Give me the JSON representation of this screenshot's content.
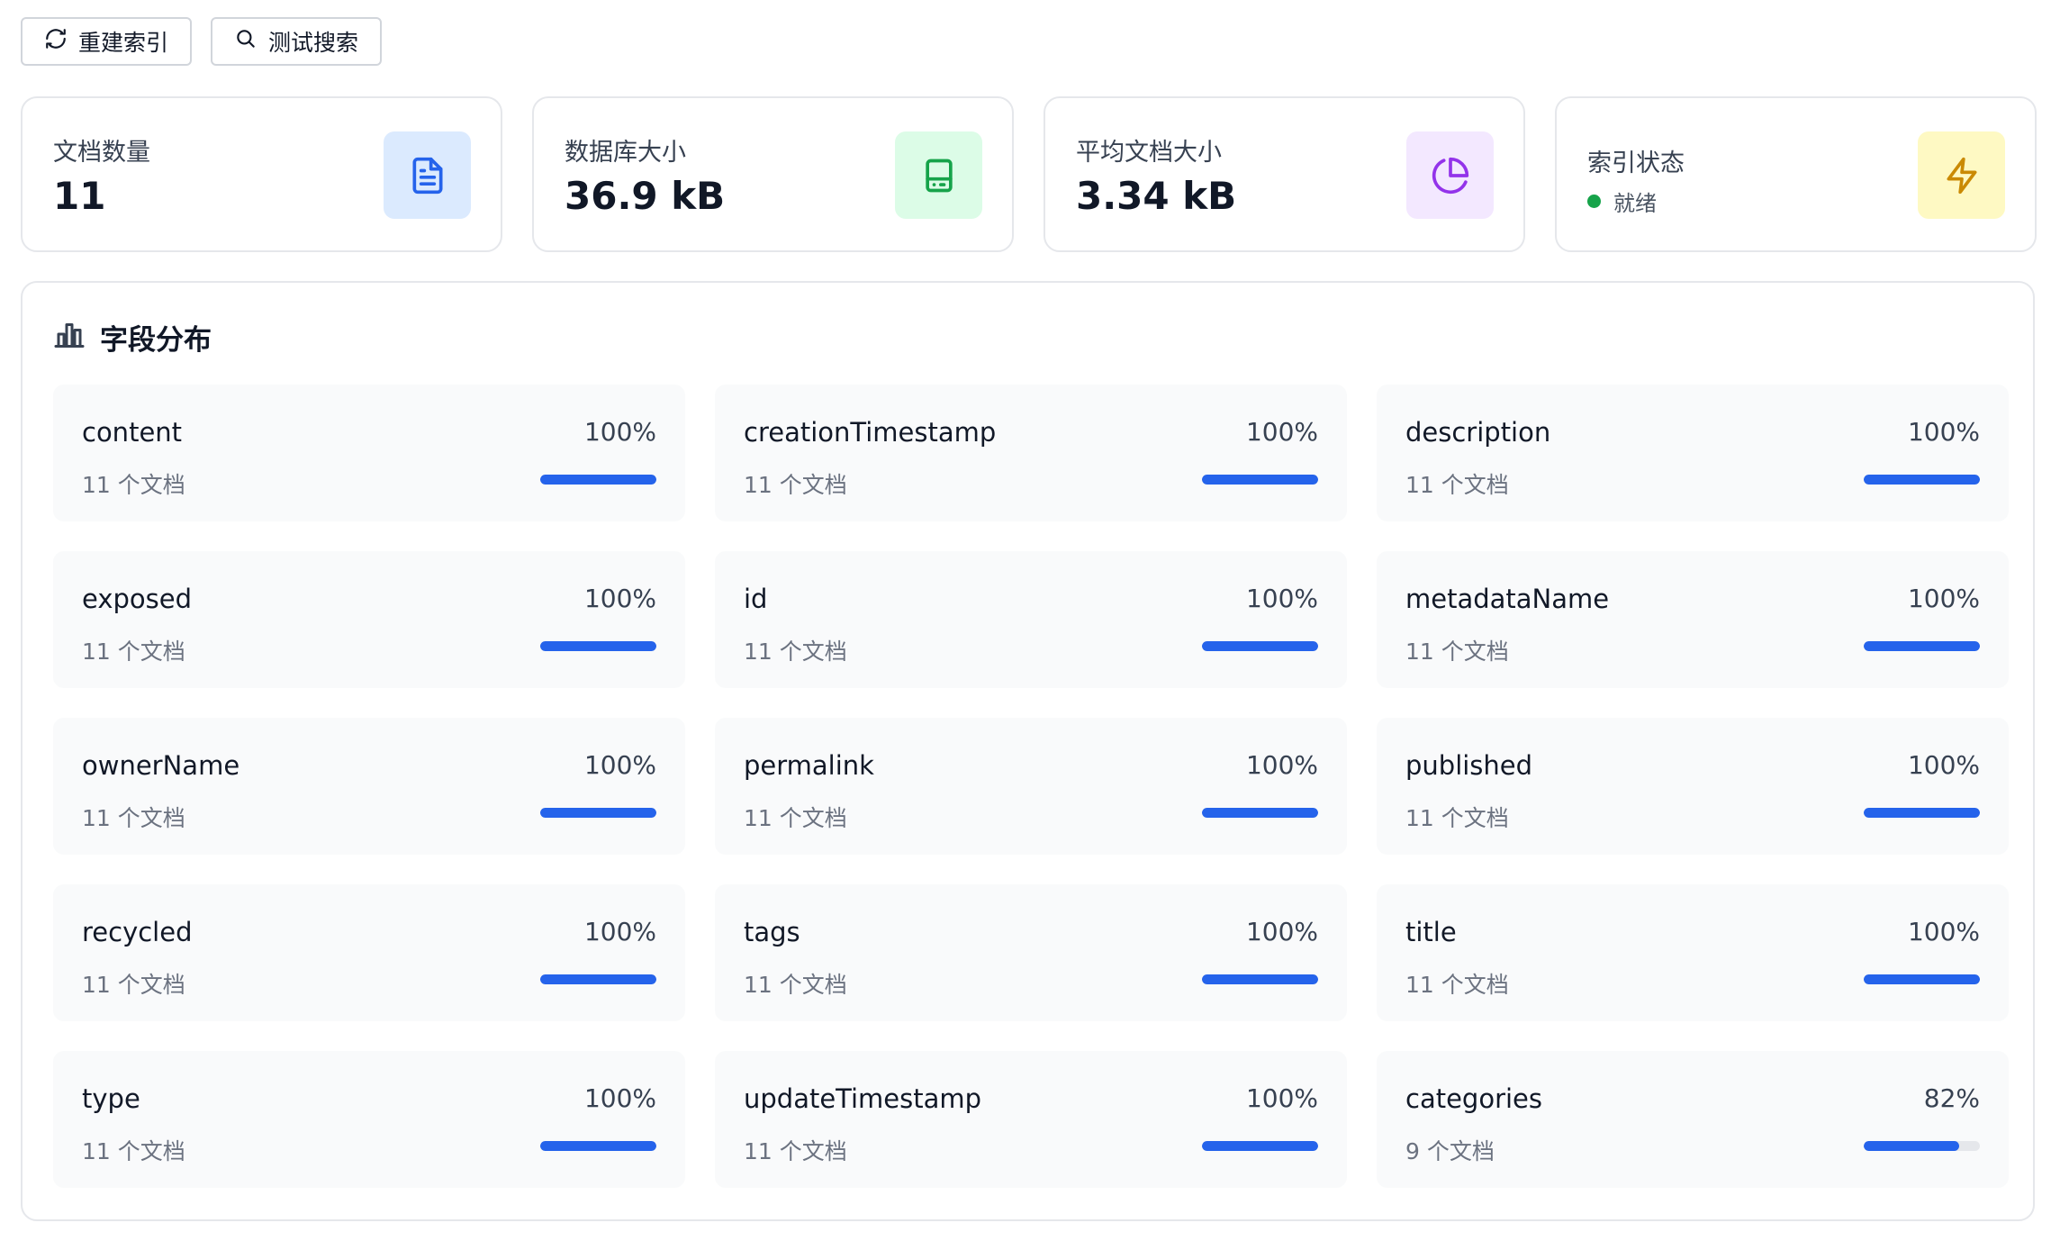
{
  "toolbar": {
    "rebuild_label": "重建索引",
    "test_search_label": "测试搜索"
  },
  "stats": [
    {
      "label": "文档数量",
      "value": "11",
      "icon": "file-text-icon",
      "icon_color": "#2563eb",
      "bg": "#dbeafe"
    },
    {
      "label": "数据库大小",
      "value": "36.9 kB",
      "icon": "hard-drive-icon",
      "icon_color": "#16a34a",
      "bg": "#dcfce7"
    },
    {
      "label": "平均文档大小",
      "value": "3.34 kB",
      "icon": "pie-chart-icon",
      "icon_color": "#9333ea",
      "bg": "#f3e8ff"
    },
    {
      "label": "索引状态",
      "status": "就绪",
      "status_color": "#16a34a",
      "icon": "zap-icon",
      "icon_color": "#ca8a04",
      "bg": "#fef9c3"
    }
  ],
  "panel": {
    "title": "字段分布",
    "fields": [
      {
        "name": "content",
        "pct": "100%",
        "count": "11 个文档",
        "ratio": 1.0
      },
      {
        "name": "creationTimestamp",
        "pct": "100%",
        "count": "11 个文档",
        "ratio": 1.0
      },
      {
        "name": "description",
        "pct": "100%",
        "count": "11 个文档",
        "ratio": 1.0
      },
      {
        "name": "exposed",
        "pct": "100%",
        "count": "11 个文档",
        "ratio": 1.0
      },
      {
        "name": "id",
        "pct": "100%",
        "count": "11 个文档",
        "ratio": 1.0
      },
      {
        "name": "metadataName",
        "pct": "100%",
        "count": "11 个文档",
        "ratio": 1.0
      },
      {
        "name": "ownerName",
        "pct": "100%",
        "count": "11 个文档",
        "ratio": 1.0
      },
      {
        "name": "permalink",
        "pct": "100%",
        "count": "11 个文档",
        "ratio": 1.0
      },
      {
        "name": "published",
        "pct": "100%",
        "count": "11 个文档",
        "ratio": 1.0
      },
      {
        "name": "recycled",
        "pct": "100%",
        "count": "11 个文档",
        "ratio": 1.0
      },
      {
        "name": "tags",
        "pct": "100%",
        "count": "11 个文档",
        "ratio": 1.0
      },
      {
        "name": "title",
        "pct": "100%",
        "count": "11 个文档",
        "ratio": 1.0
      },
      {
        "name": "type",
        "pct": "100%",
        "count": "11 个文档",
        "ratio": 1.0
      },
      {
        "name": "updateTimestamp",
        "pct": "100%",
        "count": "11 个文档",
        "ratio": 1.0
      },
      {
        "name": "categories",
        "pct": "82%",
        "count": "9 个文档",
        "ratio": 0.82
      }
    ]
  },
  "colors": {
    "accent": "#2563eb"
  }
}
